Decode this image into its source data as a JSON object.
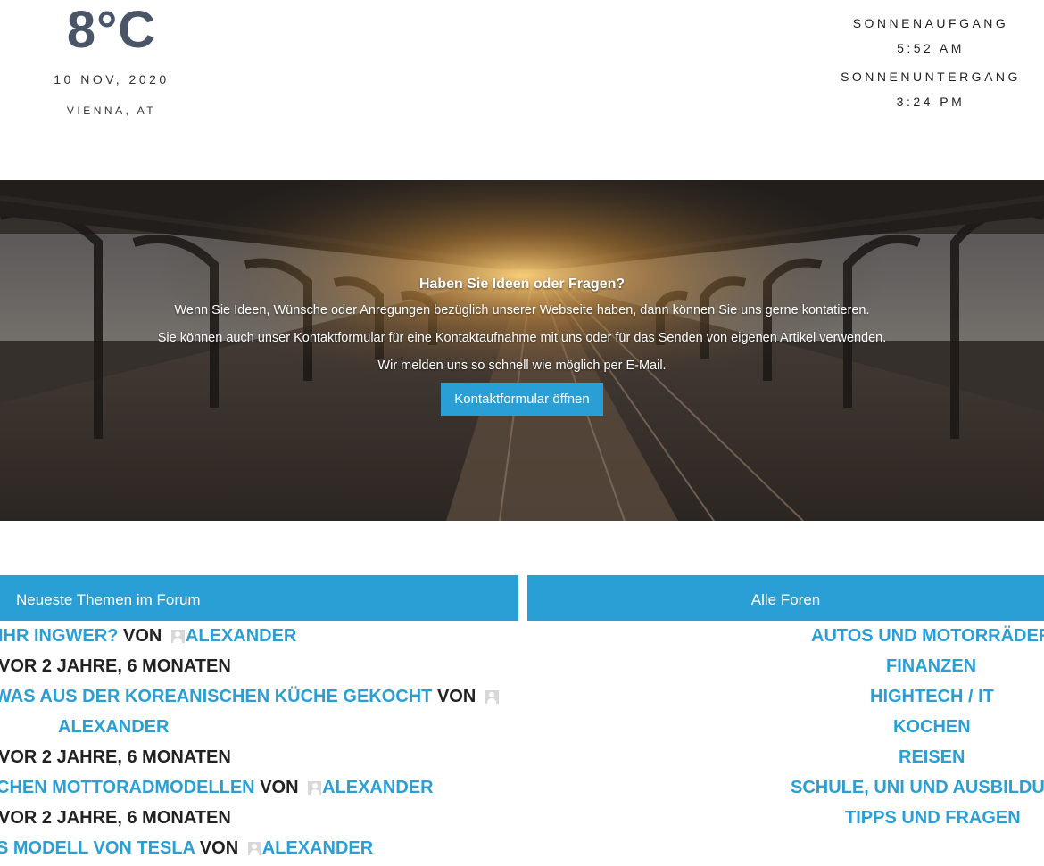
{
  "weather": {
    "temperature": "8°C",
    "date": "10 NOV, 2020",
    "location": "VIENNA, AT",
    "sunrise_label": "SONNENAUFGANG",
    "sunrise_time": "5:52 AM",
    "sunset_label": "SONNENUNTERGANG",
    "sunset_time": "3:24 PM"
  },
  "hero": {
    "title": "Haben Sie Ideen oder Fragen?",
    "paragraph_1": "Wenn Sie Ideen, Wünsche oder Anregungen bezüglich unserer Webseite haben, dann können Sie uns gerne kontatieren.",
    "paragraph_2": "Sie können auch unser Kontaktformular für eine Kontaktaufnahme mit uns oder für das Senden von eigenen Artikel verwenden.",
    "paragraph_3": "Wir melden uns so schnell wie möglich per E-Mail.",
    "button_label": "Kontaktformular öffnen"
  },
  "forum": {
    "latest_header": "Neueste Themen im Forum",
    "all_header": "Alle Foren",
    "by_word": "von",
    "topics": [
      {
        "title": "ihr Ingwer?",
        "author": "Alexander",
        "time": "vor 2 Jahre, 6 Monaten"
      },
      {
        "title": "was aus der koreanischen Küche gekocht",
        "author": "Alexander",
        "time": "vor 2 Jahre, 6 Monaten"
      },
      {
        "title": "chen Mottoradmodellen",
        "author": "Alexander",
        "time": "vor 2 Jahre, 6 Monaten"
      },
      {
        "title": "s Modell von Tesla",
        "author": "Alexander"
      }
    ],
    "forums": [
      "Autos und Motorräder",
      "Finanzen",
      "Hightech / IT",
      "Kochen",
      "Reisen",
      "Schule, Uni und Ausbildung",
      "Tipps und Fragen"
    ]
  },
  "colors": {
    "accent": "#2a9fd6",
    "temperature": "#4a5568",
    "text": "#222222"
  },
  "icons": {
    "avatar": "default-avatar-icon"
  }
}
